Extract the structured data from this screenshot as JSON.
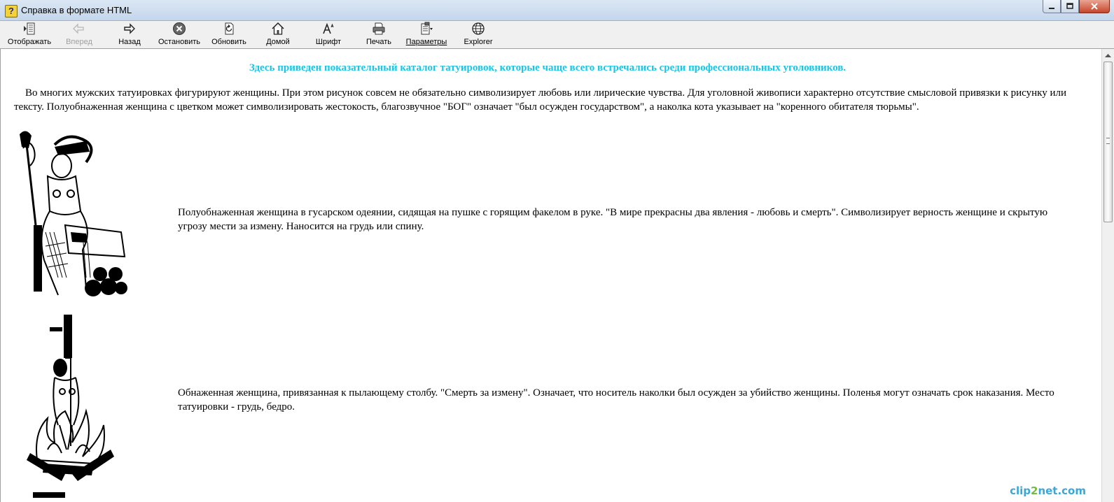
{
  "window": {
    "title": "Справка в формате HTML",
    "app_icon": "help-question-icon",
    "controls": [
      "minimize",
      "maximize",
      "close"
    ]
  },
  "toolbar": {
    "buttons": [
      {
        "label": "Отображать",
        "icon": "show-hide-pane-icon",
        "enabled": true
      },
      {
        "label": "Вперед",
        "icon": "arrow-left-icon",
        "enabled": false
      },
      {
        "label": "Назад",
        "icon": "arrow-right-icon",
        "enabled": true
      },
      {
        "label": "Остановить",
        "icon": "stop-icon",
        "enabled": true
      },
      {
        "label": "Обновить",
        "icon": "refresh-icon",
        "enabled": true
      },
      {
        "label": "Домой",
        "icon": "home-icon",
        "enabled": true
      },
      {
        "label": "Шрифт",
        "icon": "font-icon",
        "enabled": true
      },
      {
        "label": "Печать",
        "icon": "printer-icon",
        "enabled": true
      },
      {
        "label": "Параметры",
        "icon": "options-icon",
        "enabled": true
      },
      {
        "label": "Explorer",
        "icon": "explorer-globe-icon",
        "enabled": true
      }
    ]
  },
  "content": {
    "heading": "Здесь приведен показательный каталог татуировок, которые чаще всего встречались среди профессиональных уголовников.",
    "intro": "Во многих мужских татуировках фигурируют женщины. При этом рисунок совсем не обязательно символизирует любовь или лирические чувства. Для уголовной живописи характерно отсутствие смысловой привязки к рисунку или тексту. Полуобнаженная женщина с цветком может символизировать жестокость, благозвучное \"БОГ\" означает \"был осужден государством\", а наколка кота указывает на \"коренного обитателя тюрьмы\".",
    "entries": [
      {
        "description": "Полуобнаженная женщина в гусарском одеянии, сидящая на пушке с горящим факелом в руке. \"В мире прекрасны два явления - любовь и смерть\". Символизирует верность женщине и скрытую угрозу мести за измену. Наносится на грудь или спину."
      },
      {
        "description": "Обнаженная женщина, привязанная к пылающему столбу. \"Смерть за измену\". Означает, что носитель наколки был осужден за убийство женщины. Поленья могут означать срок наказания. Место татуировки - грудь, бедро."
      }
    ]
  },
  "watermark": {
    "part1": "clip",
    "part2": "2",
    "part3": "net.com"
  }
}
